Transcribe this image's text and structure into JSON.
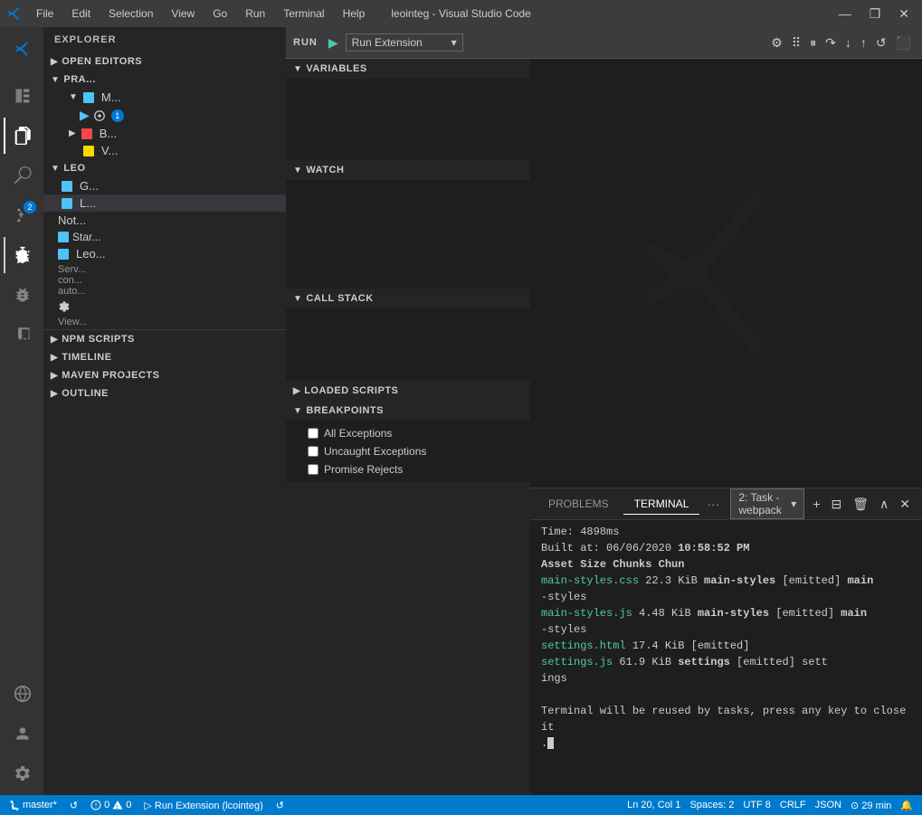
{
  "titlebar": {
    "title": "leointeg - Visual Studio Code",
    "menu": [
      "File",
      "Edit",
      "Selection",
      "View",
      "Go",
      "Run",
      "Terminal",
      "Help"
    ],
    "controls": [
      "—",
      "❐",
      "✕"
    ]
  },
  "run_toolbar": {
    "label": "RUN",
    "dropdown": "Run Extension",
    "badge": "1"
  },
  "debug_sections": {
    "variables": "VARIABLES",
    "watch": "WATCH",
    "call_stack": "CALL STACK",
    "loaded_scripts": "LOADED SCRIPTS",
    "breakpoints": "BREAKPOINTS"
  },
  "breakpoints": {
    "items": [
      {
        "label": "All Exceptions",
        "checked": false
      },
      {
        "label": "Uncaught Exceptions",
        "checked": false
      },
      {
        "label": "Promise Rejects",
        "checked": false
      }
    ]
  },
  "sidebar_bottom": {
    "sections": [
      {
        "label": "NPM SCRIPTS"
      },
      {
        "label": "TIMELINE"
      },
      {
        "label": "MAVEN PROJECTS"
      },
      {
        "label": "OUTLINE"
      }
    ]
  },
  "terminal": {
    "tabs": [
      {
        "label": "PROBLEMS"
      },
      {
        "label": "TERMINAL",
        "active": true
      },
      {
        "label": "..."
      }
    ],
    "dropdown": "2: Task - webpack",
    "output": {
      "line1": "Time:  4898ms",
      "line2_pre": "Built at: 06/06/2020 ",
      "line2_bold": "10:58:52 PM",
      "header": "       Asset              Size        Chunks",
      "header2": "Chun",
      "row1_file": "  main-styles.css",
      "row1_size": " 22.3 KiB ",
      "row1_chunk": "main-styles",
      "row1_emitted": " [emitted] ",
      "row1_name": "main",
      "row1_cont": "-styles",
      "row2_file": "    main-styles.js",
      "row2_size": "  4.48 KiB ",
      "row2_chunk": "main-styles",
      "row2_emitted": " [emitted] ",
      "row2_name": "main",
      "row2_cont": "-styles",
      "row3_file": "   settings.html",
      "row3_size": " 17.4 KiB",
      "row3_emitted": "           [emitted]",
      "row4_file": "    settings.js",
      "row4_size": " 61.9 KiB  ",
      "row4_chunk": "settings",
      "row4_emitted": " [emitted] ",
      "row4_cont": "sett",
      "row4_cont2": "ings",
      "footer": "Terminal will be reused by tasks, press any key to close it"
    }
  },
  "statusbar": {
    "branch": "master*",
    "sync": "↺",
    "errors": "⊘ 0",
    "warnings": "⚠ 0",
    "run_ext": "▷ Run Extension (lcointeg)",
    "history": "↺",
    "position": "Ln 20, Col 1",
    "spaces": "Spaces: 2",
    "encoding": "UTF 8",
    "line_ending": "CRLF",
    "language": "JSON",
    "clock": "⊙ 29 min",
    "bell": "🔔"
  },
  "explorer": {
    "sections": [
      {
        "label": "EXPLORER",
        "collapsed": false
      },
      {
        "label": "OPEN EDITORS",
        "collapsed": true
      },
      {
        "label": "PRA...",
        "collapsed": false
      }
    ],
    "leo_section": "LEO",
    "leo_items": [
      {
        "label": "Not...",
        "indent": 0
      },
      {
        "label": "Star...",
        "indent": 0
      },
      {
        "label": "Leo...",
        "indent": 0
      },
      {
        "label": "Serv...",
        "indent": 0
      }
    ]
  }
}
